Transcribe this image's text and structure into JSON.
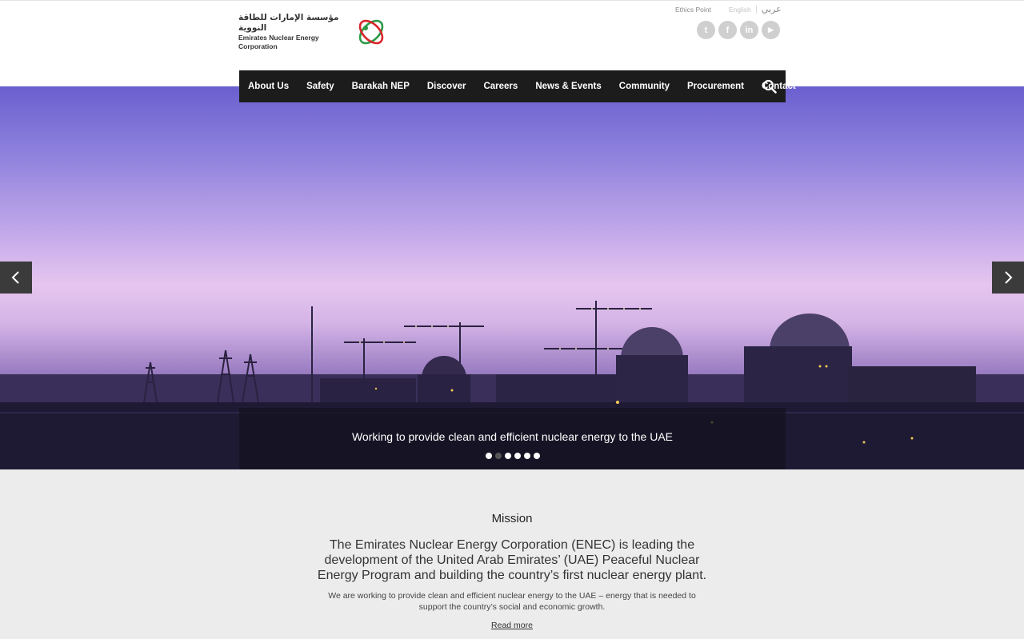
{
  "brand": {
    "name_ar": "مؤسسة الإمارات للطاقة النووية",
    "name_en": "Emirates Nuclear Energy Corporation"
  },
  "utility": {
    "ethics": "Ethics Point",
    "english": "English",
    "arabic": "عربي"
  },
  "socials": [
    {
      "icon": "twitter-icon",
      "glyph": "t"
    },
    {
      "icon": "facebook-icon",
      "glyph": "f"
    },
    {
      "icon": "linkedin-icon",
      "glyph": "in"
    },
    {
      "icon": "youtube-icon",
      "glyph": "▶"
    }
  ],
  "nav": {
    "items": [
      "About Us",
      "Safety",
      "Barakah NEP",
      "Discover",
      "Careers",
      "News & Events",
      "Community",
      "Procurement",
      "Contact"
    ],
    "search_icon": "search-icon"
  },
  "hero": {
    "caption": "Working to provide clean and efficient nuclear energy to the UAE",
    "slides_total": 6,
    "active_slide": 1
  },
  "mission": {
    "title": "Mission",
    "lead": "The Emirates Nuclear Energy Corporation (ENEC) is leading the development of the United Arab Emirates’ (UAE) Peaceful Nuclear Energy Program and building the country’s first nuclear energy plant.",
    "body": "We are working to provide clean and efficient nuclear energy to the UAE – energy that is needed to support the country’s social and economic growth.",
    "read_more": "Read more"
  },
  "colors": {
    "nav_bg": "#1c1c1c",
    "logo_green": "#2e9a47",
    "logo_red": "#d9262b",
    "page_bg": "#ececec"
  }
}
